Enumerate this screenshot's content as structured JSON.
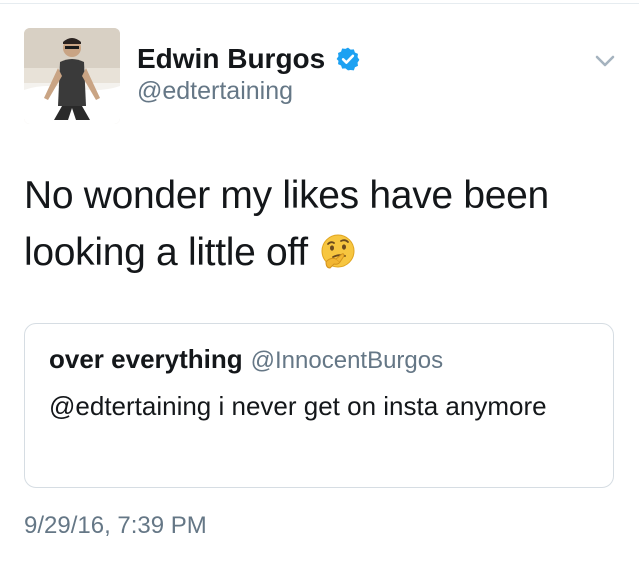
{
  "tweet": {
    "author": {
      "name": "Edwin Burgos",
      "handle": "@edtertaining",
      "verified": true,
      "avatar_icon": "profile-photo"
    },
    "text": "No wonder my likes have been looking a little off",
    "emoji": "thinking-face-emoji",
    "quoted": {
      "name": "over everything",
      "handle": "@InnocentBurgos",
      "text": "@edtertaining i never get on insta anymore"
    },
    "timestamp": "9/29/16, 7:39 PM"
  },
  "colors": {
    "text": "#14171a",
    "secondary": "#657786",
    "verified_blue": "#1da1f2",
    "border": "#d6dde3"
  }
}
